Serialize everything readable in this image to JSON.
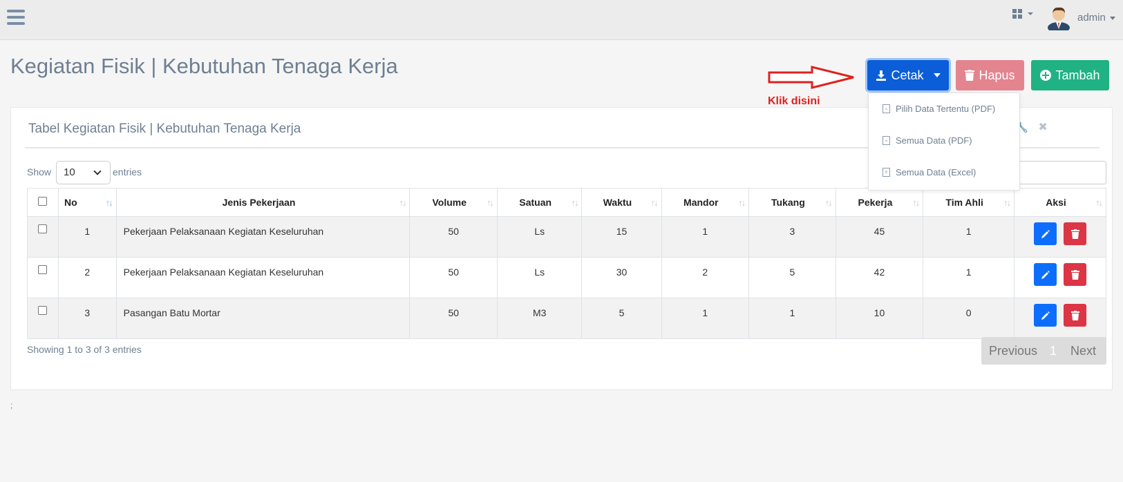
{
  "header": {
    "user_name": "admin"
  },
  "page": {
    "title": "Kegiatan Fisik | Kebutuhan Tenaga Kerja"
  },
  "actions": {
    "cetak": "Cetak",
    "hapus": "Hapus",
    "tambah": "Tambah"
  },
  "annotation": {
    "hint": "Klik disini"
  },
  "dropdown": {
    "items": [
      {
        "label": "Pilih Data Tertentu (PDF)"
      },
      {
        "label": "Semua Data (PDF)"
      },
      {
        "label": "Semua Data (Excel)"
      }
    ]
  },
  "panel": {
    "title": "Tabel Kegiatan Fisik | Kebutuhan Tenaga Kerja",
    "show_label": "Show",
    "page_size": "10",
    "entries_label": "entries",
    "info": "Showing 1 to 3 of 3 entries"
  },
  "table": {
    "columns": [
      "No",
      "Jenis Pekerjaan",
      "Volume",
      "Satuan",
      "Waktu",
      "Mandor",
      "Tukang",
      "Pekerja",
      "Tim Ahli",
      "Aksi"
    ],
    "rows": [
      {
        "no": "1",
        "jenis": "Pekerjaan Pelaksanaan Kegiatan Keseluruhan",
        "volume": "50",
        "satuan": "Ls",
        "waktu": "15",
        "mandor": "1",
        "tukang": "3",
        "pekerja": "45",
        "tim_ahli": "1"
      },
      {
        "no": "2",
        "jenis": "Pekerjaan Pelaksanaan Kegiatan Keseluruhan",
        "volume": "50",
        "satuan": "Ls",
        "waktu": "30",
        "mandor": "2",
        "tukang": "5",
        "pekerja": "42",
        "tim_ahli": "1"
      },
      {
        "no": "3",
        "jenis": "Pasangan Batu Mortar",
        "volume": "50",
        "satuan": "M3",
        "waktu": "5",
        "mandor": "1",
        "tukang": "1",
        "pekerja": "10",
        "tim_ahli": "0"
      }
    ]
  },
  "pagination": {
    "previous": "Previous",
    "current": "1",
    "next": "Next"
  },
  "footer": {
    "note": ";"
  },
  "colors": {
    "primary": "#0b5ed7",
    "danger": "#dc3545",
    "success": "#20b283",
    "hint": "#e0201d"
  }
}
